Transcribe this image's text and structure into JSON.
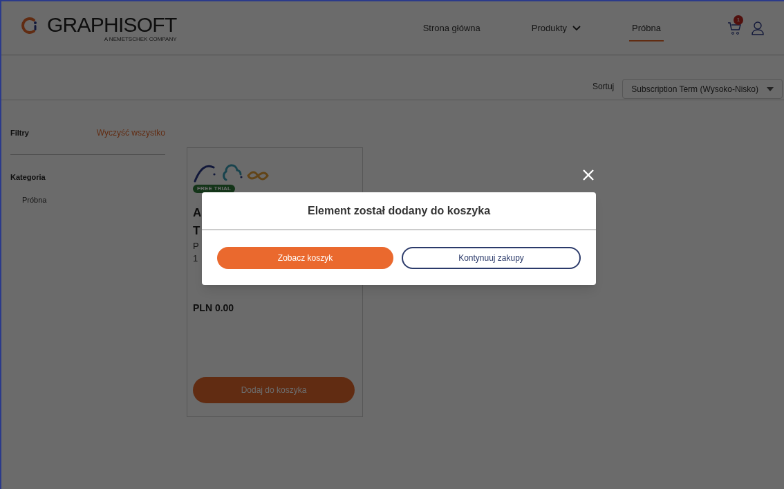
{
  "header": {
    "logo": {
      "name": "GRAPHISOFT",
      "tagline": "A NEMETSCHEK COMPANY"
    },
    "nav": [
      {
        "label": "Strona główna",
        "selected": false,
        "kind": "link"
      },
      {
        "label": "Produkty",
        "selected": false,
        "kind": "dropdown"
      },
      {
        "label": "Próbna",
        "selected": true,
        "kind": "link"
      }
    ],
    "cart_count": "1"
  },
  "sort": {
    "label": "Sortuj",
    "value": "Subscription Term (Wysoko-Nisko)"
  },
  "filters": {
    "title": "Filtry",
    "clear": "Wyczyść wszystko",
    "category": {
      "title": "Kategoria",
      "items": [
        "Próbna"
      ]
    }
  },
  "product": {
    "badge": "FREE TRIAL",
    "title_lines": [
      "A",
      "T"
    ],
    "description_lines": [
      "P",
      "1"
    ],
    "price": "PLN 0.00",
    "button": "Dodaj do koszyka"
  },
  "modal": {
    "title": "Element został dodany do koszyka",
    "buttons": [
      {
        "label": "Zobacz koszyk",
        "kind": "primary"
      },
      {
        "label": "Kontynuuj zakupy",
        "kind": "secondary"
      }
    ]
  }
}
